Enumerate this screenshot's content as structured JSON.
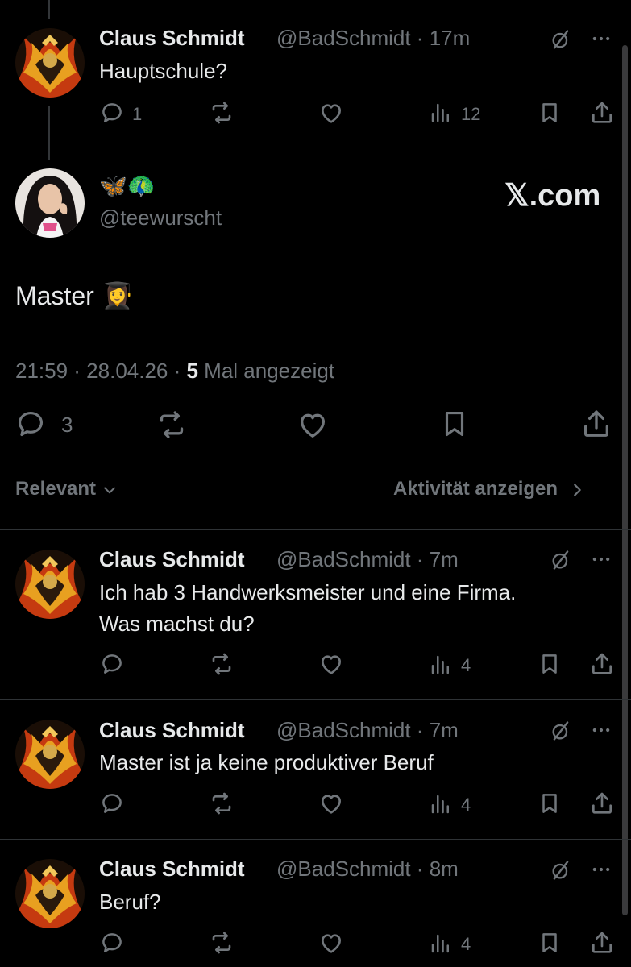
{
  "thread": {
    "parent": {
      "name": "Claus Schmidt",
      "handle": "@BadSchmidt",
      "time": "17m",
      "text": "Hauptschule?",
      "replies": "1",
      "views": "12"
    },
    "main": {
      "display_name": "🦋🦚",
      "handle": "@teewurscht",
      "watermark": "𝕏.com",
      "text": "Master 👩‍🎓",
      "timestamp": "21:59 · 28.04.26 · ",
      "views_count": "5",
      "views_label": " Mal angezeigt",
      "replies": "3"
    },
    "sort": {
      "label": "Relevant",
      "activity_label": "Aktivität anzeigen"
    },
    "replies": [
      {
        "name": "Claus Schmidt",
        "handle": "@BadSchmidt",
        "time": "7m",
        "text_line1": "Ich hab 3 Handwerksmeister und eine Firma.",
        "text_line2": "Was machst du?",
        "views": "4"
      },
      {
        "name": "Claus Schmidt",
        "handle": "@BadSchmidt",
        "time": "7m",
        "text_line1": "Master ist ja keine produktiver Beruf",
        "views": "4"
      },
      {
        "name": "Claus Schmidt",
        "handle": "@BadSchmidt",
        "time": "8m",
        "text_line1": "Beruf?",
        "views": "4"
      }
    ]
  },
  "colors": {
    "background": "#000000",
    "text": "#e7e9ea",
    "muted": "#71767b",
    "divider": "#2f3336"
  },
  "icons": [
    "reply-icon",
    "repost-icon",
    "like-icon",
    "views-icon",
    "bookmark-icon",
    "share-icon",
    "grok-icon",
    "more-icon",
    "chevron-down-icon",
    "chevron-right-icon"
  ]
}
